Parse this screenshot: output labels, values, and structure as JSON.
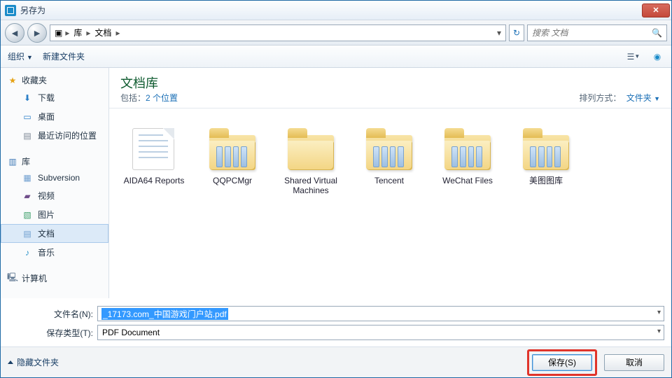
{
  "window": {
    "title": "另存为"
  },
  "nav": {
    "crumbs": [
      "库",
      "文档"
    ],
    "search_placeholder": "搜索 文档"
  },
  "toolbar": {
    "organize": "组织",
    "new_folder": "新建文件夹"
  },
  "sidebar": {
    "groups": [
      {
        "label": "收藏夹",
        "icon": "star",
        "items": [
          {
            "label": "下载",
            "icon": "download"
          },
          {
            "label": "桌面",
            "icon": "desktop"
          },
          {
            "label": "最近访问的位置",
            "icon": "recent"
          }
        ]
      },
      {
        "label": "库",
        "icon": "library",
        "items": [
          {
            "label": "Subversion",
            "icon": "file"
          },
          {
            "label": "视频",
            "icon": "video"
          },
          {
            "label": "图片",
            "icon": "picture"
          },
          {
            "label": "文档",
            "icon": "document",
            "selected": true
          },
          {
            "label": "音乐",
            "icon": "music"
          }
        ]
      },
      {
        "label": "计算机",
        "icon": "computer",
        "items": []
      }
    ]
  },
  "library_header": {
    "title": "文档库",
    "subtitle_prefix": "包括：",
    "subtitle_link": "2 个位置",
    "arrange_label": "排列方式：",
    "arrange_value": "文件夹"
  },
  "files": [
    {
      "type": "doc",
      "label": "AIDA64 Reports"
    },
    {
      "type": "folder_binders",
      "label": "QQPCMgr"
    },
    {
      "type": "folder",
      "label": "Shared Virtual Machines"
    },
    {
      "type": "folder_binders",
      "label": "Tencent"
    },
    {
      "type": "folder_binders",
      "label": "WeChat Files"
    },
    {
      "type": "folder_binders",
      "label": "美图图库"
    }
  ],
  "form": {
    "filename_label": "文件名(N):",
    "filename_value": "_17173.com_中国游戏门户站.pdf",
    "filetype_label": "保存类型(T):",
    "filetype_value": "PDF Document"
  },
  "footer": {
    "hide_folders": "隐藏文件夹",
    "save": "保存(S)",
    "cancel": "取消"
  }
}
